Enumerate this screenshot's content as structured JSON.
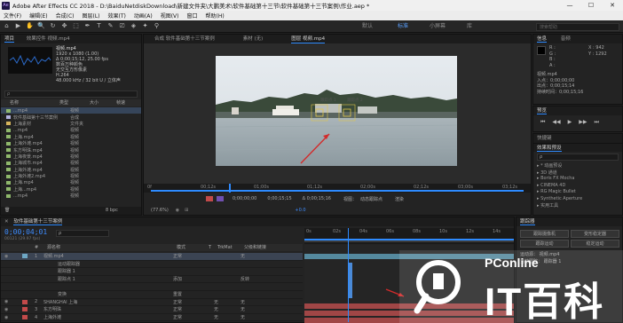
{
  "window": {
    "title": "Adobe After Effects CC 2018 - D:\\BaiduNetdiskDownload\\新建文件夹\\大鹏美术\\软件基础第十三节\\软件基础第十三节案例\\作业.aep *",
    "app_icon": "Ae",
    "minimize": "—",
    "maximize": "☐",
    "close": "✕"
  },
  "menu": [
    "文件(F)",
    "编辑(E)",
    "合成(C)",
    "图层(L)",
    "效果(T)",
    "动画(A)",
    "视图(V)",
    "窗口",
    "帮助(H)"
  ],
  "toolbar": {
    "tools": [
      "⌂",
      "▶",
      "✋",
      "🔍",
      "↻",
      "✥",
      "⬚",
      "✒",
      "T",
      "✎",
      "⎚",
      "◈",
      "✦",
      "⚲"
    ],
    "workspaces": [
      "默认",
      "标准",
      "小屏幕",
      "库"
    ],
    "active_workspace": "标准",
    "search_placeholder": "搜索帮助"
  },
  "project": {
    "tab": "项目",
    "tab2": "效果控件 视频.mp4",
    "footage_name": "视频.mp4",
    "info_lines": [
      "1920 x 1080 (1.00)",
      "Δ 0;00;15;12, 25.00 fps",
      "数百万种颜色",
      "无交互方形像素",
      "H.264",
      "48.000 kHz / 32 bit U / 立体声"
    ],
    "search_placeholder": "ρ",
    "columns": [
      "名称",
      "类型",
      "大小",
      "帧速"
    ],
    "items": [
      {
        "name": "...mp4",
        "type": "视频",
        "color": "#8fb86b"
      },
      {
        "name": "软件基础第十三节案例",
        "type": "合成",
        "color": "#b3b3e0"
      },
      {
        "name": "上海素材",
        "type": "文件夹",
        "color": "#d6b45c"
      },
      {
        "name": "...mp4",
        "type": "视频",
        "color": "#8fb86b"
      },
      {
        "name": "上海.mp4",
        "type": "视频",
        "color": "#8fb86b"
      },
      {
        "name": "上海外滩.mp4",
        "type": "视频",
        "color": "#8fb86b"
      },
      {
        "name": "东方明珠.mp4",
        "type": "视频",
        "color": "#8fb86b"
      },
      {
        "name": "上海夜景.mp4",
        "type": "视频",
        "color": "#8fb86b"
      },
      {
        "name": "上海城市.mp4",
        "type": "视频",
        "color": "#8fb86b"
      },
      {
        "name": "上海外滩.mp4",
        "type": "视频",
        "color": "#8fb86b"
      },
      {
        "name": "上海外滩2.mp4",
        "type": "视频",
        "color": "#8fb86b"
      },
      {
        "name": "上海.mp4",
        "type": "视频",
        "color": "#8fb86b"
      },
      {
        "name": "上海...mp4",
        "type": "视频",
        "color": "#8fb86b"
      },
      {
        "name": "...mp4",
        "type": "视频",
        "color": "#8fb86b"
      }
    ],
    "bpc": "8 bpc"
  },
  "viewer": {
    "tabs": [
      "合成 软件基础第十三节案例",
      "素材 (无)",
      "图层 视频.mp4"
    ],
    "active_tab": "图层 视频.mp4",
    "tracker_labels": [
      "跟踪点 1",
      "跟踪点 2"
    ],
    "ruler_ticks": [
      "0f",
      "00;12s",
      "01;00s",
      "01;12s",
      "02;00s",
      "02;12s",
      "03;00s",
      "03;12s"
    ],
    "footer": {
      "zoom": "(77.6%)",
      "timecode_in": "0;00;00;00",
      "timecode_out": "0;00;15;15",
      "duration": "Δ 0;00;15;16",
      "view_label": "视图：",
      "view_value": "动态跟踪点",
      "render_label": "渲染",
      "exposure": "+0.0"
    }
  },
  "info_panel": {
    "tabs": [
      "信息",
      "音频"
    ],
    "r": "R :",
    "g": "G :",
    "b": "B :",
    "a": "A :",
    "x": "X : 942",
    "y": "Y : 1292",
    "clip_name": "视频.mp4",
    "clip_lines": [
      "入点：0;00;00;00",
      "出点：0;00;15;14",
      "持续时间：0;00;15;16"
    ]
  },
  "preview": {
    "tab": "预览",
    "controls": [
      "⏮",
      "◀◀",
      "▶",
      "▶▶",
      "⏭"
    ]
  },
  "effects": {
    "tab_shortcut": "快捷键",
    "tab": "效果和预设",
    "search_placeholder": "ρ",
    "items": [
      "▸ * 动画预设",
      "▸ 3D 通道",
      "▸ Boris FX Mocha",
      "▸ CINEMA 4D",
      "▸ RG Magic Bullet",
      "▸ Synthetic Aperture",
      "▸ 实用工具"
    ]
  },
  "tracker": {
    "tab": "跟踪器",
    "buttons": [
      "跟踪摄像机",
      "变形稳定器",
      "跟踪运动",
      "稳定运动"
    ],
    "motion_source_label": "运动源：",
    "motion_source_value": "视频.mp4",
    "current_track_label": "当前跟踪：",
    "current_track_value": "跟踪器 1"
  },
  "timeline": {
    "tab": "软件基础第十三节案例",
    "timecode": "0;00;04;01",
    "fps_note": "00121 (29.97 fps)",
    "search_placeholder": "ρ",
    "col_headers": [
      "#",
      "源名称",
      "模式",
      "T",
      "TrkMat",
      "父级和链接"
    ],
    "layers": [
      {
        "num": "1",
        "name": "视频.mp4",
        "mode": "正常",
        "trk": "",
        "parent": "无",
        "color": "#6ea7c4"
      },
      {
        "num": "",
        "name": "运动跟踪器",
        "mode": "",
        "trk": "",
        "parent": "",
        "color": ""
      },
      {
        "num": "",
        "name": "跟踪器 1",
        "mode": "",
        "trk": "",
        "parent": "",
        "color": ""
      },
      {
        "num": "",
        "name": "跟踪点 1",
        "mode": "添加",
        "trk": "",
        "parent": "反转",
        "color": ""
      },
      {
        "num": "",
        "name": "",
        "mode": "",
        "trk": "",
        "parent": "",
        "color": ""
      },
      {
        "num": "",
        "name": "变换",
        "mode": "重置",
        "trk": "",
        "parent": "",
        "color": ""
      },
      {
        "num": "2",
        "name": "SHANGHAI 上海",
        "mode": "正常",
        "trk": "无",
        "parent": "无",
        "color": "#c24a4a"
      },
      {
        "num": "3",
        "name": "东方明珠",
        "mode": "正常",
        "trk": "无",
        "parent": "无",
        "color": "#c24a4a"
      },
      {
        "num": "4",
        "name": "上海外滩",
        "mode": "正常",
        "trk": "无",
        "parent": "无",
        "color": "#c24a4a"
      }
    ],
    "ruler_ticks": [
      "0s",
      "02s",
      "04s",
      "06s",
      "08s",
      "10s",
      "12s",
      "14s"
    ]
  },
  "watermark": {
    "brand": "PConline",
    "name": "IT百科"
  },
  "colors": {
    "accent": "#2e8bff",
    "timecode": "#3d8cff",
    "arrow": "#d22b2b"
  }
}
